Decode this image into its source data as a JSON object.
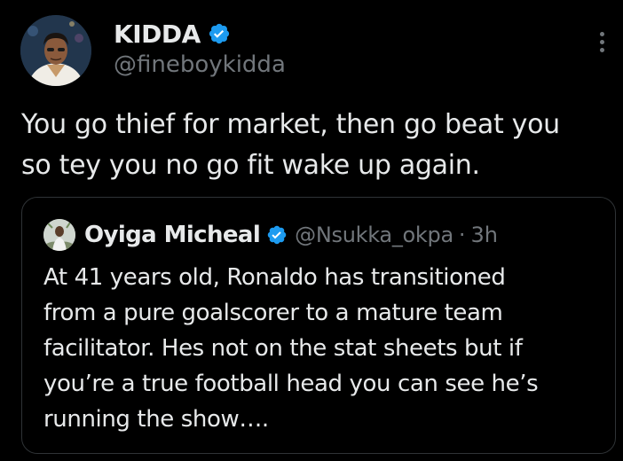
{
  "tweet": {
    "author": {
      "display_name": "KIDDA",
      "handle": "@fineboykidda",
      "verified_icon": "verified-badge-icon",
      "avatar_icon": "profile-avatar"
    },
    "text_lines": [
      "You go thief for market, then go beat you",
      "so tey you no go fit wake up again."
    ],
    "more_icon": "more-options-icon"
  },
  "quoted_tweet": {
    "author": {
      "display_name": "Oyiga Micheal",
      "handle": "@Nsukka_okpa",
      "verified_icon": "verified-badge-icon",
      "avatar_icon": "profile-avatar"
    },
    "separator": "·",
    "time": "3h",
    "text_lines": [
      "At 41 years old, Ronaldo has transitioned",
      "from a pure goalscorer to a mature team",
      "facilitator. Hes not on the stat sheets but if",
      "you’re a true football head you can see he’s",
      "running the show…."
    ]
  },
  "colors": {
    "background": "#000000",
    "primary_text": "#e7e9ea",
    "secondary_text": "#71767b",
    "verified_blue": "#1d9bf0",
    "border": "#2f3336"
  }
}
